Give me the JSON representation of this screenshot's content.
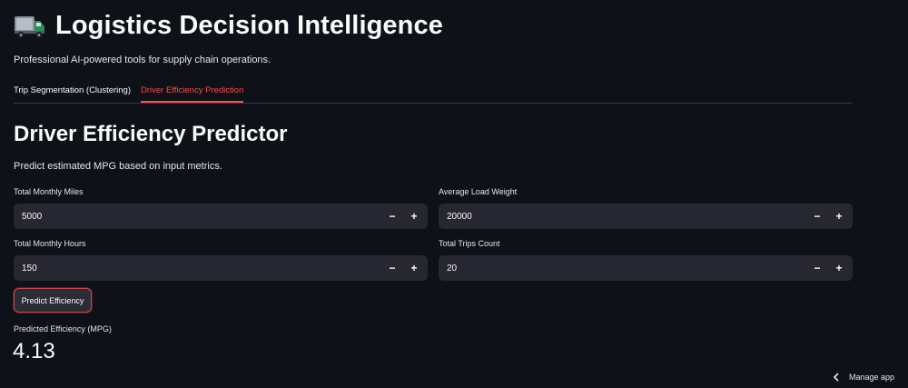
{
  "header": {
    "icon": "delivery-truck-icon",
    "title": "Logistics Decision Intelligence",
    "subtitle": "Professional AI-powered tools for supply chain operations."
  },
  "tabs": [
    {
      "label": "Trip Segmentation (Clustering)",
      "active": false
    },
    {
      "label": "Driver Efficiency Prediction",
      "active": true
    }
  ],
  "section": {
    "title": "Driver Efficiency Predictor",
    "description": "Predict estimated MPG based on input metrics."
  },
  "inputs": {
    "total_monthly_miles": {
      "label": "Total Monthly Miles",
      "value": "5000"
    },
    "average_load_weight": {
      "label": "Average Load Weight",
      "value": "20000"
    },
    "total_monthly_hours": {
      "label": "Total Monthly Hours",
      "value": "150"
    },
    "total_trips_count": {
      "label": "Total Trips Count",
      "value": "20"
    }
  },
  "stepper": {
    "minus": "−",
    "plus": "+"
  },
  "predict_button": {
    "label": "Predict Efficiency"
  },
  "result": {
    "label": "Predicted Efficiency (MPG)",
    "value": "4.13"
  },
  "footer": {
    "manage_app": "Manage app"
  },
  "colors": {
    "background": "#0e1117",
    "input_bg": "#262730",
    "accent": "#ff4b4b",
    "text": "#fafafa"
  }
}
